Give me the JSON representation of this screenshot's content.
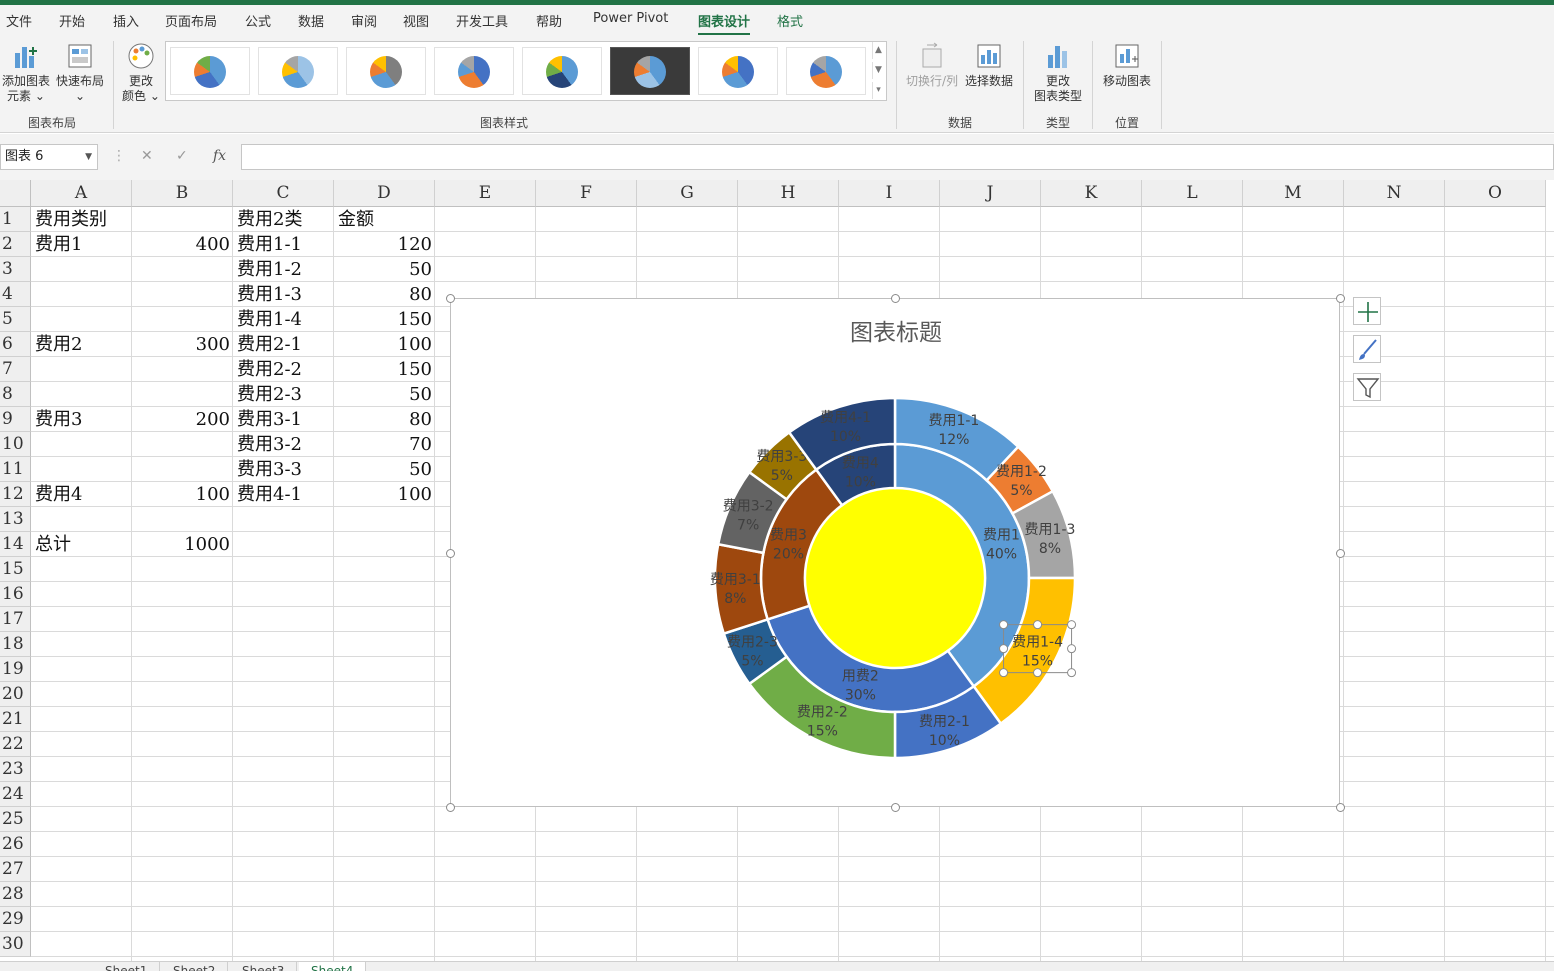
{
  "ribbon_tabs": [
    "文件",
    "开始",
    "插入",
    "页面布局",
    "公式",
    "数据",
    "审阅",
    "视图",
    "开发工具",
    "帮助",
    "Power Pivot",
    "图表设计",
    "格式"
  ],
  "ribbon": {
    "add_element_line1": "添加图表",
    "add_element_line2": "元素",
    "quick_layout": "快速布局",
    "change_colors_line1": "更改",
    "change_colors_line2": "颜色",
    "group_layout": "图表布局",
    "group_styles": "图表样式",
    "switch_row_col": "切换行/列",
    "select_data": "选择数据",
    "group_data": "数据",
    "change_type_line1": "更改",
    "change_type_line2": "图表类型",
    "group_type": "类型",
    "move_chart": "移动图表",
    "group_location": "位置"
  },
  "formula_bar": {
    "name_box": "图表 6",
    "fx": "fx",
    "formula": ""
  },
  "columns": [
    "A",
    "B",
    "C",
    "D",
    "E",
    "F",
    "G",
    "H",
    "I",
    "J",
    "K",
    "L",
    "M",
    "N",
    "O"
  ],
  "rows": [
    "1",
    "2",
    "3",
    "4",
    "5",
    "6",
    "7",
    "8",
    "9",
    "10",
    "11",
    "12",
    "13",
    "14",
    "15",
    "16",
    "17",
    "18",
    "19",
    "20",
    "21",
    "22",
    "23",
    "24",
    "25",
    "26",
    "27",
    "28",
    "29",
    "30"
  ],
  "cells": {
    "A1": "费用类别",
    "C1": "费用2类",
    "D1": "金额",
    "A2": "费用1",
    "B2": "400",
    "C2": "费用1-1",
    "D2": "120",
    "C3": "费用1-2",
    "D3": "50",
    "C4": "费用1-3",
    "D4": "80",
    "C5": "费用1-4",
    "D5": "150",
    "A6": "费用2",
    "B6": "300",
    "C6": "费用2-1",
    "D6": "100",
    "C7": "费用2-2",
    "D7": "150",
    "C8": "费用2-3",
    "D8": "50",
    "A9": "费用3",
    "B9": "200",
    "C9": "费用3-1",
    "D9": "80",
    "C10": "费用3-2",
    "D10": "70",
    "C11": "费用3-3",
    "D11": "50",
    "A12": "费用4",
    "B12": "100",
    "C12": "费用4-1",
    "D12": "100",
    "A14": "总计",
    "B14": "1000"
  },
  "chart_data": {
    "type": "pie",
    "subtype": "doughnut-two-level",
    "title": "图表标题",
    "legend": "none",
    "center_fill": "#FFFF00",
    "inner_ring": [
      {
        "label": "费用1",
        "value": 400,
        "pct": "40%",
        "color": "#5B9BD5"
      },
      {
        "label": "用费2",
        "value": 300,
        "pct": "30%",
        "color": "#4472C4"
      },
      {
        "label": "费用3",
        "value": 200,
        "pct": "20%",
        "color": "#9E480E"
      },
      {
        "label": "费用4",
        "value": 100,
        "pct": "10%",
        "color": "#264478"
      }
    ],
    "outer_ring": [
      {
        "label": "费用1-1",
        "value": 120,
        "pct": "12%",
        "color": "#5B9BD5"
      },
      {
        "label": "费用1-2",
        "value": 50,
        "pct": "5%",
        "color": "#ED7D31"
      },
      {
        "label": "费用1-3",
        "value": 80,
        "pct": "8%",
        "color": "#A5A5A5"
      },
      {
        "label": "费用1-4",
        "value": 150,
        "pct": "15%",
        "color": "#FFC000"
      },
      {
        "label": "费用2-1",
        "value": 100,
        "pct": "10%",
        "color": "#4472C4"
      },
      {
        "label": "费用2-2",
        "value": 150,
        "pct": "15%",
        "color": "#70AD47"
      },
      {
        "label": "费用2-3",
        "value": 50,
        "pct": "5%",
        "color": "#255E91"
      },
      {
        "label": "费用3-1",
        "value": 80,
        "pct": "8%",
        "color": "#9E480E"
      },
      {
        "label": "费用3-2",
        "value": 70,
        "pct": "7%",
        "color": "#636363"
      },
      {
        "label": "费用3-3",
        "value": 50,
        "pct": "5%",
        "color": "#997300"
      },
      {
        "label": "费用4-1",
        "value": 100,
        "pct": "10%",
        "color": "#264478"
      }
    ]
  },
  "sheet_tabs": [
    "Sheet1",
    "Sheet2",
    "Sheet3",
    "Sheet4"
  ],
  "accent_color": "#217346"
}
